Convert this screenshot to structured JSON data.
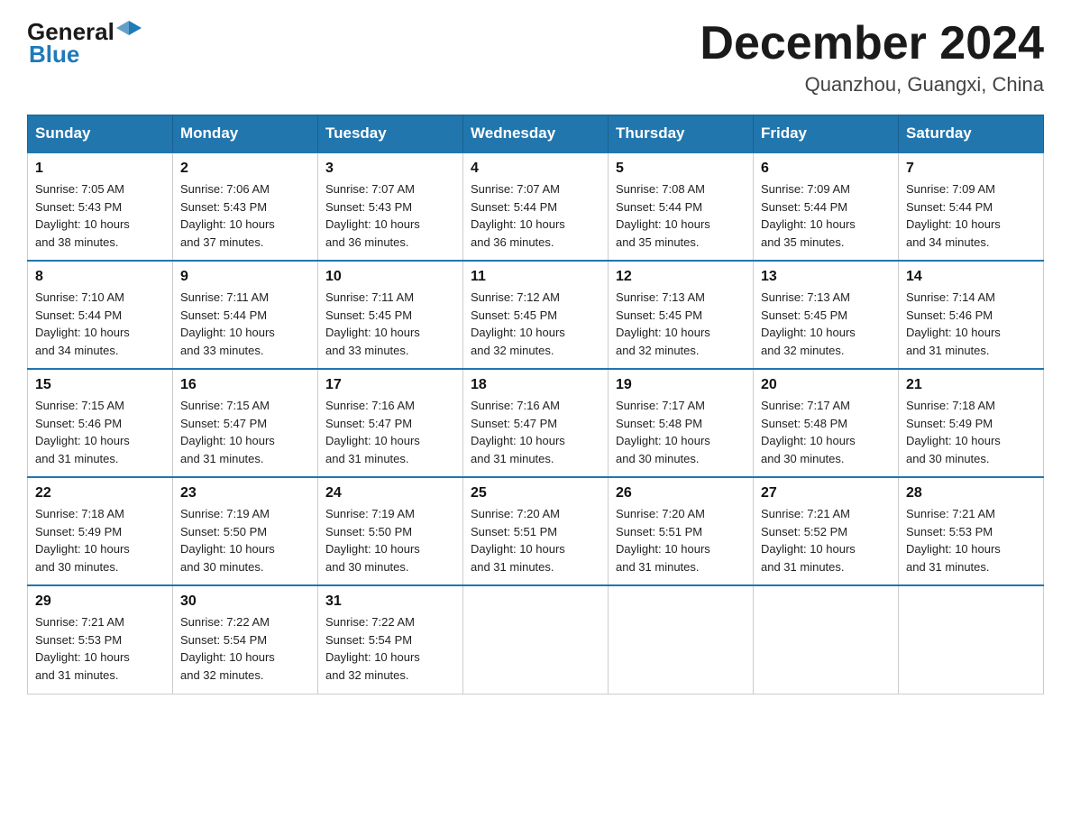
{
  "header": {
    "logo": {
      "text_general": "General",
      "text_blue": "Blue"
    },
    "title": "December 2024",
    "location": "Quanzhou, Guangxi, China"
  },
  "weekdays": [
    "Sunday",
    "Monday",
    "Tuesday",
    "Wednesday",
    "Thursday",
    "Friday",
    "Saturday"
  ],
  "weeks": [
    [
      {
        "day": "1",
        "sunrise": "7:05 AM",
        "sunset": "5:43 PM",
        "daylight": "10 hours and 38 minutes."
      },
      {
        "day": "2",
        "sunrise": "7:06 AM",
        "sunset": "5:43 PM",
        "daylight": "10 hours and 37 minutes."
      },
      {
        "day": "3",
        "sunrise": "7:07 AM",
        "sunset": "5:43 PM",
        "daylight": "10 hours and 36 minutes."
      },
      {
        "day": "4",
        "sunrise": "7:07 AM",
        "sunset": "5:44 PM",
        "daylight": "10 hours and 36 minutes."
      },
      {
        "day": "5",
        "sunrise": "7:08 AM",
        "sunset": "5:44 PM",
        "daylight": "10 hours and 35 minutes."
      },
      {
        "day": "6",
        "sunrise": "7:09 AM",
        "sunset": "5:44 PM",
        "daylight": "10 hours and 35 minutes."
      },
      {
        "day": "7",
        "sunrise": "7:09 AM",
        "sunset": "5:44 PM",
        "daylight": "10 hours and 34 minutes."
      }
    ],
    [
      {
        "day": "8",
        "sunrise": "7:10 AM",
        "sunset": "5:44 PM",
        "daylight": "10 hours and 34 minutes."
      },
      {
        "day": "9",
        "sunrise": "7:11 AM",
        "sunset": "5:44 PM",
        "daylight": "10 hours and 33 minutes."
      },
      {
        "day": "10",
        "sunrise": "7:11 AM",
        "sunset": "5:45 PM",
        "daylight": "10 hours and 33 minutes."
      },
      {
        "day": "11",
        "sunrise": "7:12 AM",
        "sunset": "5:45 PM",
        "daylight": "10 hours and 32 minutes."
      },
      {
        "day": "12",
        "sunrise": "7:13 AM",
        "sunset": "5:45 PM",
        "daylight": "10 hours and 32 minutes."
      },
      {
        "day": "13",
        "sunrise": "7:13 AM",
        "sunset": "5:45 PM",
        "daylight": "10 hours and 32 minutes."
      },
      {
        "day": "14",
        "sunrise": "7:14 AM",
        "sunset": "5:46 PM",
        "daylight": "10 hours and 31 minutes."
      }
    ],
    [
      {
        "day": "15",
        "sunrise": "7:15 AM",
        "sunset": "5:46 PM",
        "daylight": "10 hours and 31 minutes."
      },
      {
        "day": "16",
        "sunrise": "7:15 AM",
        "sunset": "5:47 PM",
        "daylight": "10 hours and 31 minutes."
      },
      {
        "day": "17",
        "sunrise": "7:16 AM",
        "sunset": "5:47 PM",
        "daylight": "10 hours and 31 minutes."
      },
      {
        "day": "18",
        "sunrise": "7:16 AM",
        "sunset": "5:47 PM",
        "daylight": "10 hours and 31 minutes."
      },
      {
        "day": "19",
        "sunrise": "7:17 AM",
        "sunset": "5:48 PM",
        "daylight": "10 hours and 30 minutes."
      },
      {
        "day": "20",
        "sunrise": "7:17 AM",
        "sunset": "5:48 PM",
        "daylight": "10 hours and 30 minutes."
      },
      {
        "day": "21",
        "sunrise": "7:18 AM",
        "sunset": "5:49 PM",
        "daylight": "10 hours and 30 minutes."
      }
    ],
    [
      {
        "day": "22",
        "sunrise": "7:18 AM",
        "sunset": "5:49 PM",
        "daylight": "10 hours and 30 minutes."
      },
      {
        "day": "23",
        "sunrise": "7:19 AM",
        "sunset": "5:50 PM",
        "daylight": "10 hours and 30 minutes."
      },
      {
        "day": "24",
        "sunrise": "7:19 AM",
        "sunset": "5:50 PM",
        "daylight": "10 hours and 30 minutes."
      },
      {
        "day": "25",
        "sunrise": "7:20 AM",
        "sunset": "5:51 PM",
        "daylight": "10 hours and 31 minutes."
      },
      {
        "day": "26",
        "sunrise": "7:20 AM",
        "sunset": "5:51 PM",
        "daylight": "10 hours and 31 minutes."
      },
      {
        "day": "27",
        "sunrise": "7:21 AM",
        "sunset": "5:52 PM",
        "daylight": "10 hours and 31 minutes."
      },
      {
        "day": "28",
        "sunrise": "7:21 AM",
        "sunset": "5:53 PM",
        "daylight": "10 hours and 31 minutes."
      }
    ],
    [
      {
        "day": "29",
        "sunrise": "7:21 AM",
        "sunset": "5:53 PM",
        "daylight": "10 hours and 31 minutes."
      },
      {
        "day": "30",
        "sunrise": "7:22 AM",
        "sunset": "5:54 PM",
        "daylight": "10 hours and 32 minutes."
      },
      {
        "day": "31",
        "sunrise": "7:22 AM",
        "sunset": "5:54 PM",
        "daylight": "10 hours and 32 minutes."
      },
      null,
      null,
      null,
      null
    ]
  ]
}
